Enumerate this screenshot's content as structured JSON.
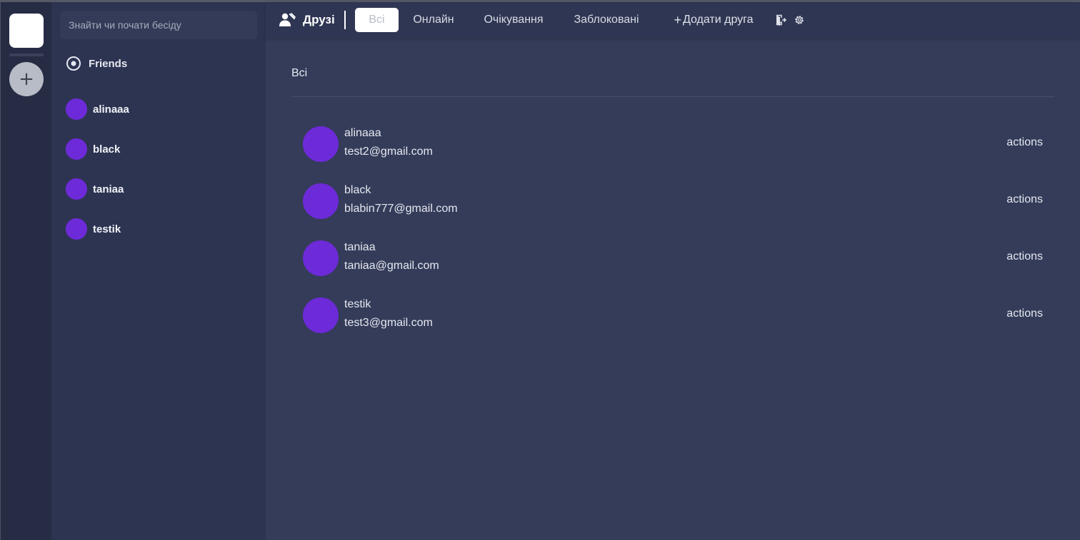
{
  "rail": {
    "home_icon": "home-square-icon",
    "add_server_symbol": "+"
  },
  "sidebar": {
    "search_placeholder": "Знайти чи почати бесіду",
    "friends_label": "Friends",
    "dms": [
      {
        "name": "alinaaa"
      },
      {
        "name": "black"
      },
      {
        "name": "taniaa"
      },
      {
        "name": "testik"
      }
    ]
  },
  "header": {
    "title": "Друзі",
    "tabs": [
      {
        "label": "Всі",
        "active": true
      },
      {
        "label": "Онлайн",
        "active": false
      },
      {
        "label": "Очікування",
        "active": false
      },
      {
        "label": "Заблоковані",
        "active": false
      }
    ],
    "add_friend_label": "Додати друга",
    "add_friend_symbol": "+"
  },
  "main": {
    "section_title": "Всі",
    "friends": [
      {
        "name": "alinaaa",
        "email": "test2@gmail.com",
        "actions": "actions"
      },
      {
        "name": "black",
        "email": "blabin777@gmail.com",
        "actions": "actions"
      },
      {
        "name": "taniaa",
        "email": "taniaa@gmail.com",
        "actions": "actions"
      },
      {
        "name": "testik",
        "email": "test3@gmail.com",
        "actions": "actions"
      }
    ]
  },
  "colors": {
    "background": "#343c5a",
    "sidebar": "#2d3452",
    "rail": "#262c44",
    "avatar": "#6d2ad8",
    "active_tab_bg": "#ffffff"
  }
}
